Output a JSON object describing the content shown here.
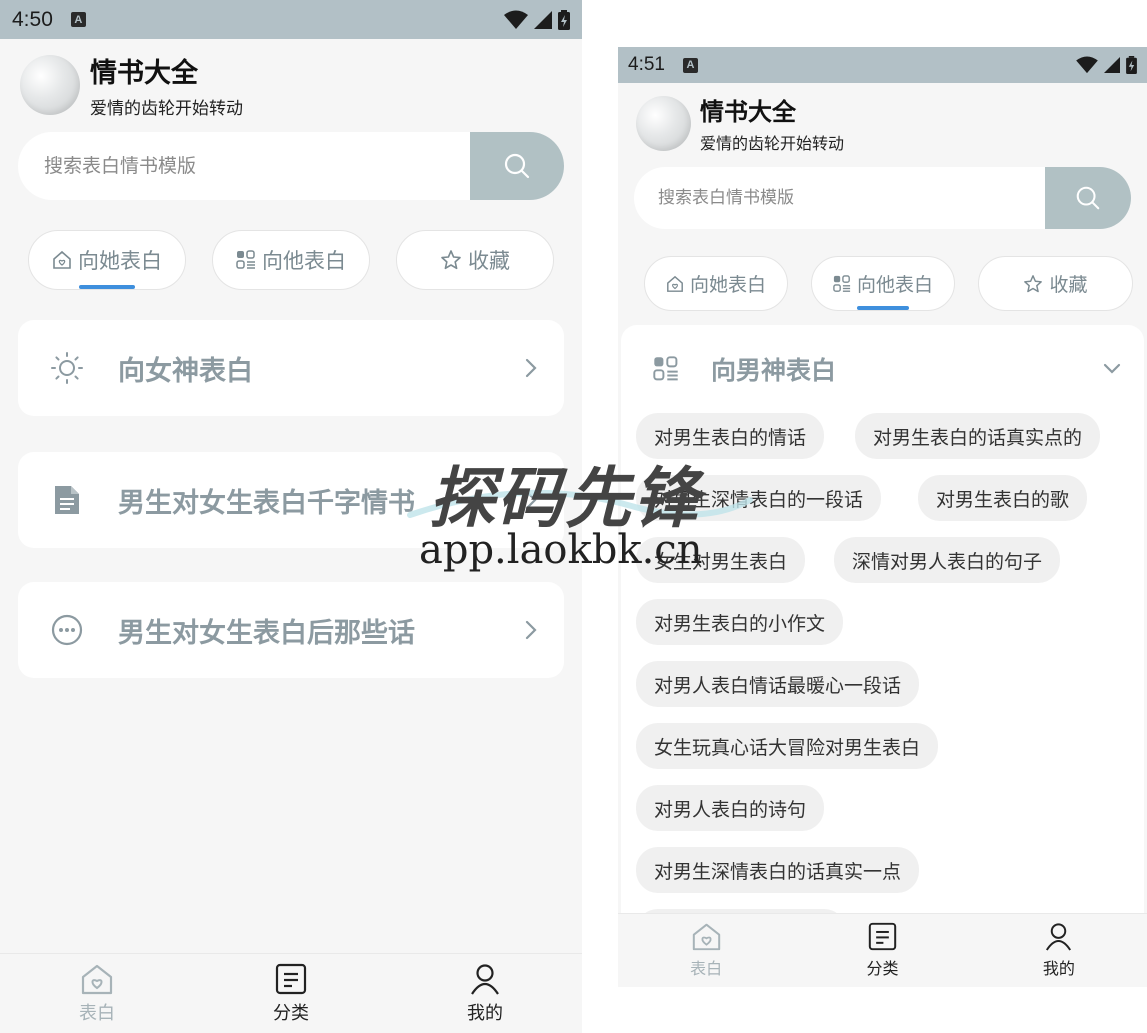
{
  "status_left": {
    "time": "4:50",
    "badge": "A"
  },
  "status_right": {
    "time": "4:51",
    "badge": "A"
  },
  "app": {
    "title": "情书大全",
    "subtitle": "爱情的齿轮开始转动"
  },
  "search": {
    "placeholder": "搜索表白情书模版"
  },
  "tabs": [
    {
      "label": "向她表白",
      "icon": "home-heart-icon"
    },
    {
      "label": "向他表白",
      "icon": "grid-icon"
    },
    {
      "label": "收藏",
      "icon": "star-icon"
    }
  ],
  "left_categories": [
    {
      "label": "向女神表白",
      "icon": "sun-icon"
    },
    {
      "label": "男生对女生表白千字情书",
      "icon": "document-icon"
    },
    {
      "label": "男生对女生表白后那些话",
      "icon": "chat-dots-icon"
    }
  ],
  "right_section": {
    "title": "向男神表白",
    "icon": "grid-icon",
    "chips": [
      "对男生表白的情话",
      "对男生表白的话真实点的",
      "对男生深情表白的一段话",
      "对男生表白的歌",
      "女生对男生表白",
      "深情对男人表白的句子",
      "对男生表白的小作文",
      "对男人表白情话最暖心一段话",
      "女生玩真心话大冒险对男生表白",
      "对男人表白的诗句",
      "对男生深情表白的话真实一点"
    ]
  },
  "bottom_nav": [
    {
      "label": "表白",
      "icon": "home-heart-icon",
      "active": true
    },
    {
      "label": "分类",
      "icon": "list-icon",
      "active": false
    },
    {
      "label": "我的",
      "icon": "user-icon",
      "active": false
    }
  ],
  "watermark": {
    "title": "探码先锋",
    "url": "app.laokbk.cn"
  },
  "colors": {
    "accent": "#3e8fdd",
    "status_bar": "#b2c0c6",
    "search_button": "#b1c1c4",
    "muted_text": "#8c9aa1"
  }
}
